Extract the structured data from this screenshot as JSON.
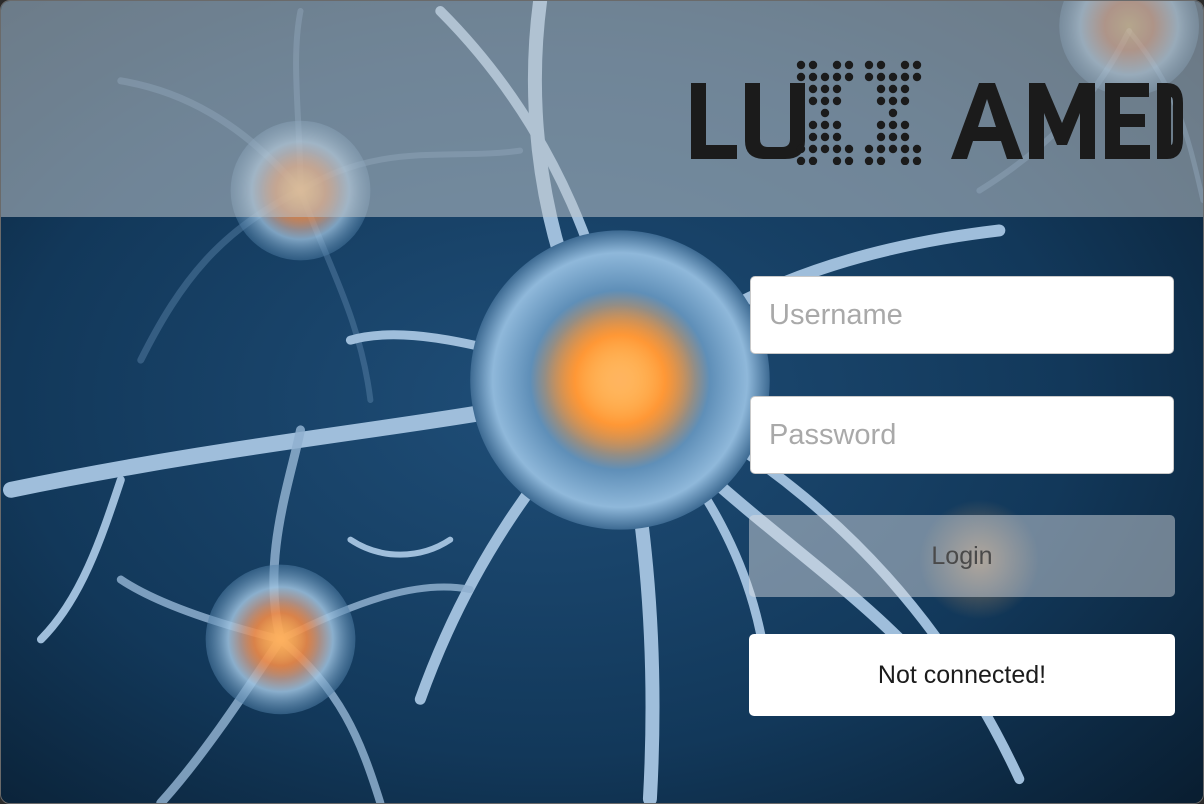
{
  "brand": {
    "logo_text": "LUXXAMED",
    "logo_color": "#1b1b1b"
  },
  "login_form": {
    "username_placeholder": "Username",
    "password_placeholder": "Password",
    "login_label": "Login",
    "status_text": "Not connected!"
  },
  "colors": {
    "header_band": "#c3c8cd",
    "neuron_glow": "#ff8a1e",
    "background_blue": "#12385a"
  },
  "background": {
    "subject": "neuron-cells-image"
  }
}
